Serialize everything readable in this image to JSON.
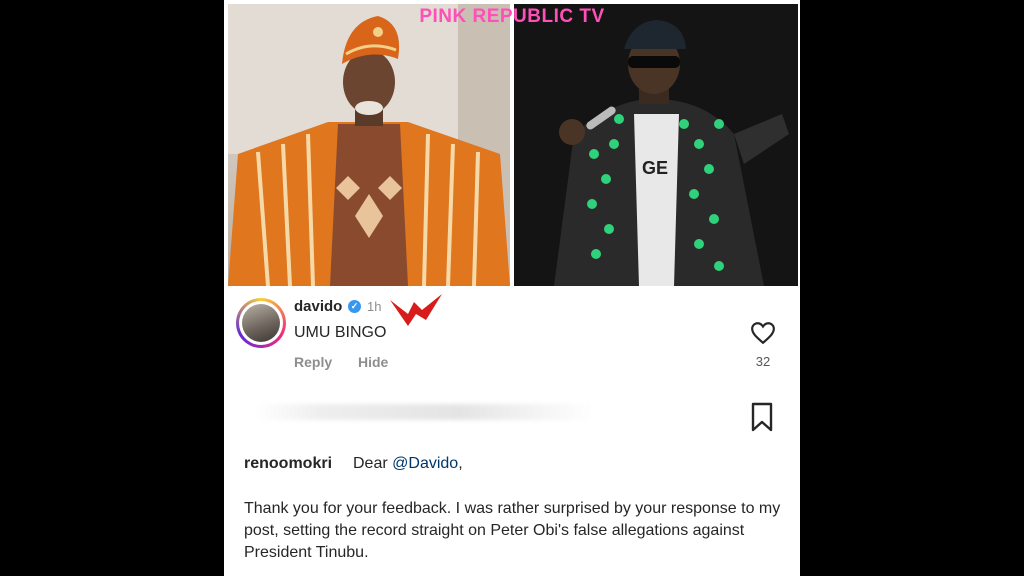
{
  "watermark": "PINK REPUBLIC TV",
  "comment": {
    "username": "davido",
    "verified_icon": "verified-badge-icon",
    "time": "1h",
    "text": "UMU BINGO",
    "reply_label": "Reply",
    "hide_label": "Hide",
    "like_count": "32"
  },
  "post": {
    "username": "renoomokri",
    "greeting": "Dear",
    "mention": "@Davido",
    "greeting_suffix": ",",
    "body": "Thank you for your feedback. I was rather surprised by your response to my post, setting the record straight on Peter Obi's false allegations against President Tinubu."
  },
  "colors": {
    "watermark": "#ff4fb8",
    "mention": "#00376b",
    "verified": "#3897f0",
    "arrow": "#d81b1b"
  }
}
